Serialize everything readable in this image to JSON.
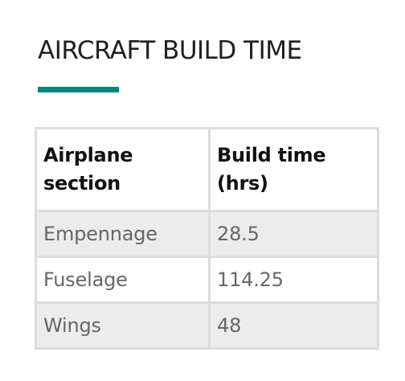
{
  "title": "AIRCRAFT BUILD TIME",
  "colors": {
    "accent": "#00897b"
  },
  "table": {
    "headers": {
      "section": "Airplane section",
      "time": "Build time (hrs)"
    },
    "rows": [
      {
        "section": "Empennage",
        "time": "28.5"
      },
      {
        "section": "Fuselage",
        "time": "114.25"
      },
      {
        "section": "Wings",
        "time": "48"
      }
    ]
  }
}
